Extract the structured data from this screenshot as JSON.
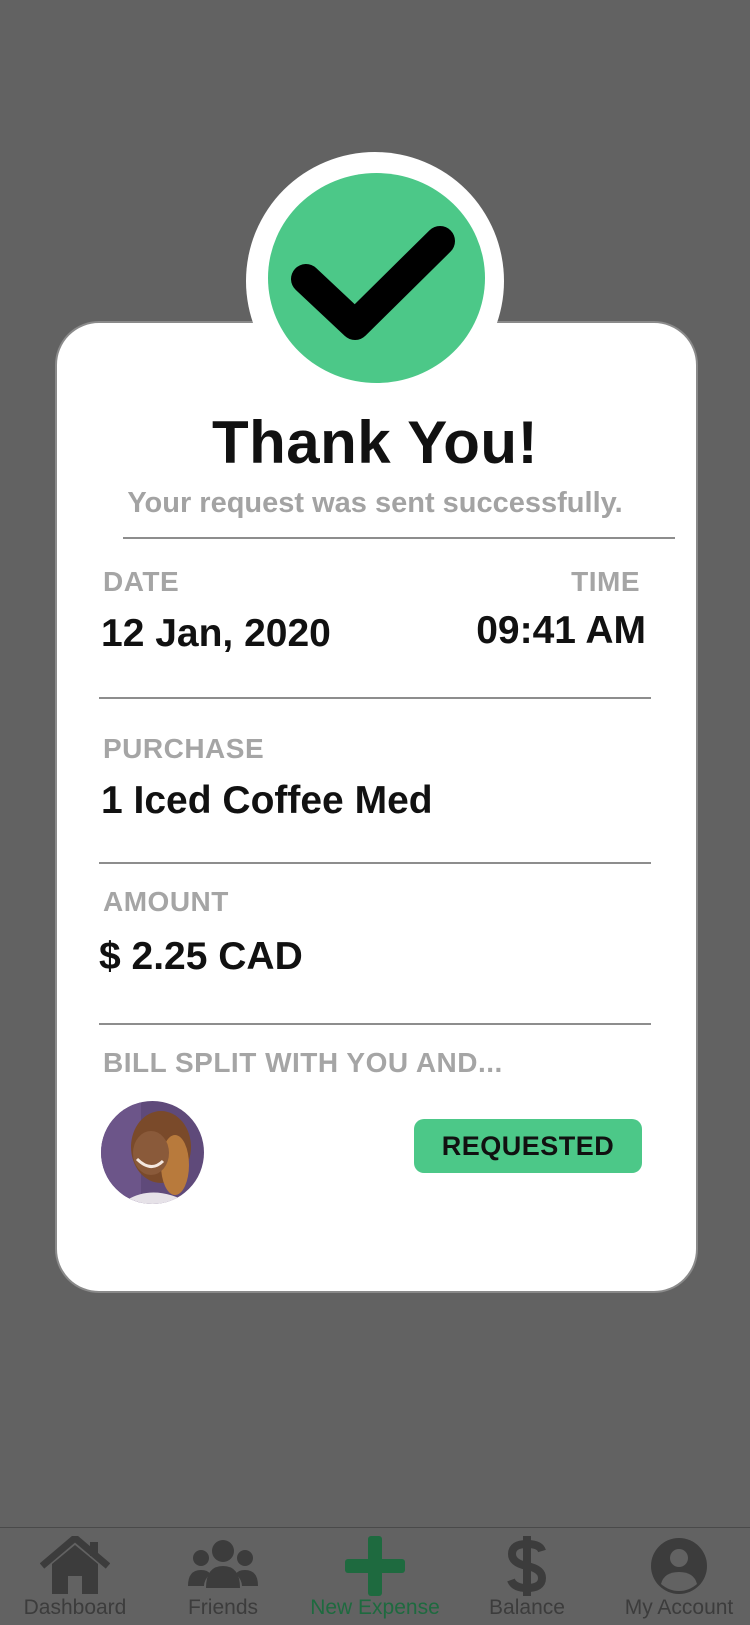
{
  "confirmation": {
    "title": "Thank You!",
    "subtitle": "Your request was sent successfully.",
    "icon": "check-icon",
    "accent_color": "#4cc888"
  },
  "details": {
    "date_label": "DATE",
    "date_value": "12 Jan, 2020",
    "time_label": "TIME",
    "time_value": "09:41 AM",
    "purchase_label": "PURCHASE",
    "purchase_value": "1 Iced Coffee Med",
    "amount_label": "AMOUNT",
    "amount_value": "$ 2.25 CAD",
    "split_label": "BILL SPLIT WITH YOU AND...",
    "split_status": "REQUESTED"
  },
  "tabbar": {
    "items": [
      {
        "label": "Dashboard",
        "icon": "home-icon"
      },
      {
        "label": "Friends",
        "icon": "friends-icon"
      },
      {
        "label": "New Expense",
        "icon": "plus-icon",
        "active": true
      },
      {
        "label": "Balance",
        "icon": "dollar-icon"
      },
      {
        "label": "My Account",
        "icon": "account-icon"
      }
    ]
  }
}
